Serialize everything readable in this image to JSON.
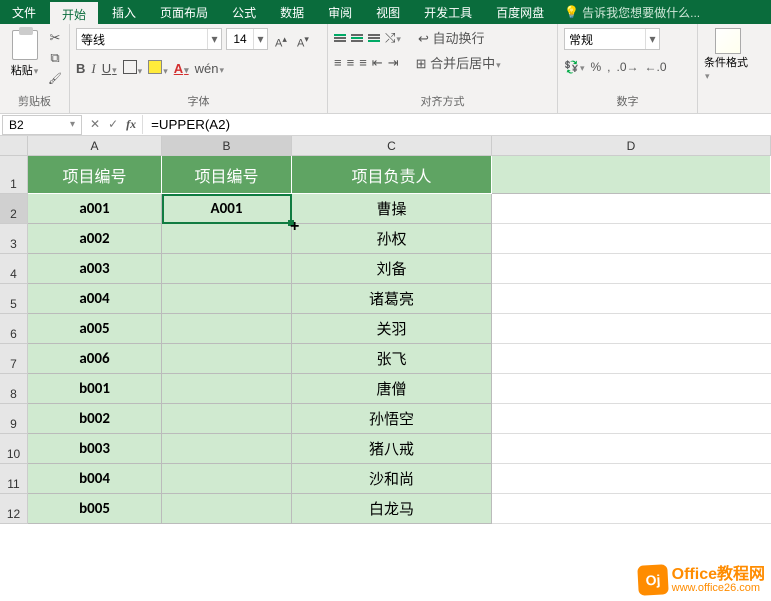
{
  "menu": {
    "file": "文件",
    "tabs": [
      "开始",
      "插入",
      "页面布局",
      "公式",
      "数据",
      "审阅",
      "视图",
      "开发工具",
      "百度网盘"
    ],
    "active_tab": "开始",
    "tellme_icon": "💡",
    "tellme": "告诉我您想要做什么..."
  },
  "ribbon": {
    "clipboard": {
      "paste": "粘贴",
      "label": "剪贴板"
    },
    "font": {
      "name": "等线",
      "size": "14",
      "wen": "wén",
      "label": "字体"
    },
    "align": {
      "wrap": "自动换行",
      "merge": "合并后居中",
      "label": "对齐方式"
    },
    "number": {
      "format": "常规",
      "label": "数字"
    },
    "styles": {
      "cond": "条件格式",
      "label": ""
    }
  },
  "namebox": "B2",
  "formula": "=UPPER(A2)",
  "columns": [
    "A",
    "B",
    "C",
    "D"
  ],
  "row_nums": [
    "1",
    "2",
    "3",
    "4",
    "5",
    "6",
    "7",
    "8",
    "9",
    "10",
    "11",
    "12"
  ],
  "headers": [
    "项目编号",
    "项目编号",
    "项目负责人"
  ],
  "rows": [
    {
      "a": "a001",
      "b": "A001",
      "c": "曹操"
    },
    {
      "a": "a002",
      "b": "",
      "c": "孙权"
    },
    {
      "a": "a003",
      "b": "",
      "c": "刘备"
    },
    {
      "a": "a004",
      "b": "",
      "c": "诸葛亮"
    },
    {
      "a": "a005",
      "b": "",
      "c": "关羽"
    },
    {
      "a": "a006",
      "b": "",
      "c": "张飞"
    },
    {
      "a": "b001",
      "b": "",
      "c": "唐僧"
    },
    {
      "a": "b002",
      "b": "",
      "c": "孙悟空"
    },
    {
      "a": "b003",
      "b": "",
      "c": "猪八戒"
    },
    {
      "a": "b004",
      "b": "",
      "c": "沙和尚"
    },
    {
      "a": "b005",
      "b": "",
      "c": "白龙马"
    }
  ],
  "watermark": {
    "badge": "Oj",
    "title": "Office教程网",
    "url": "www.office26.com"
  }
}
